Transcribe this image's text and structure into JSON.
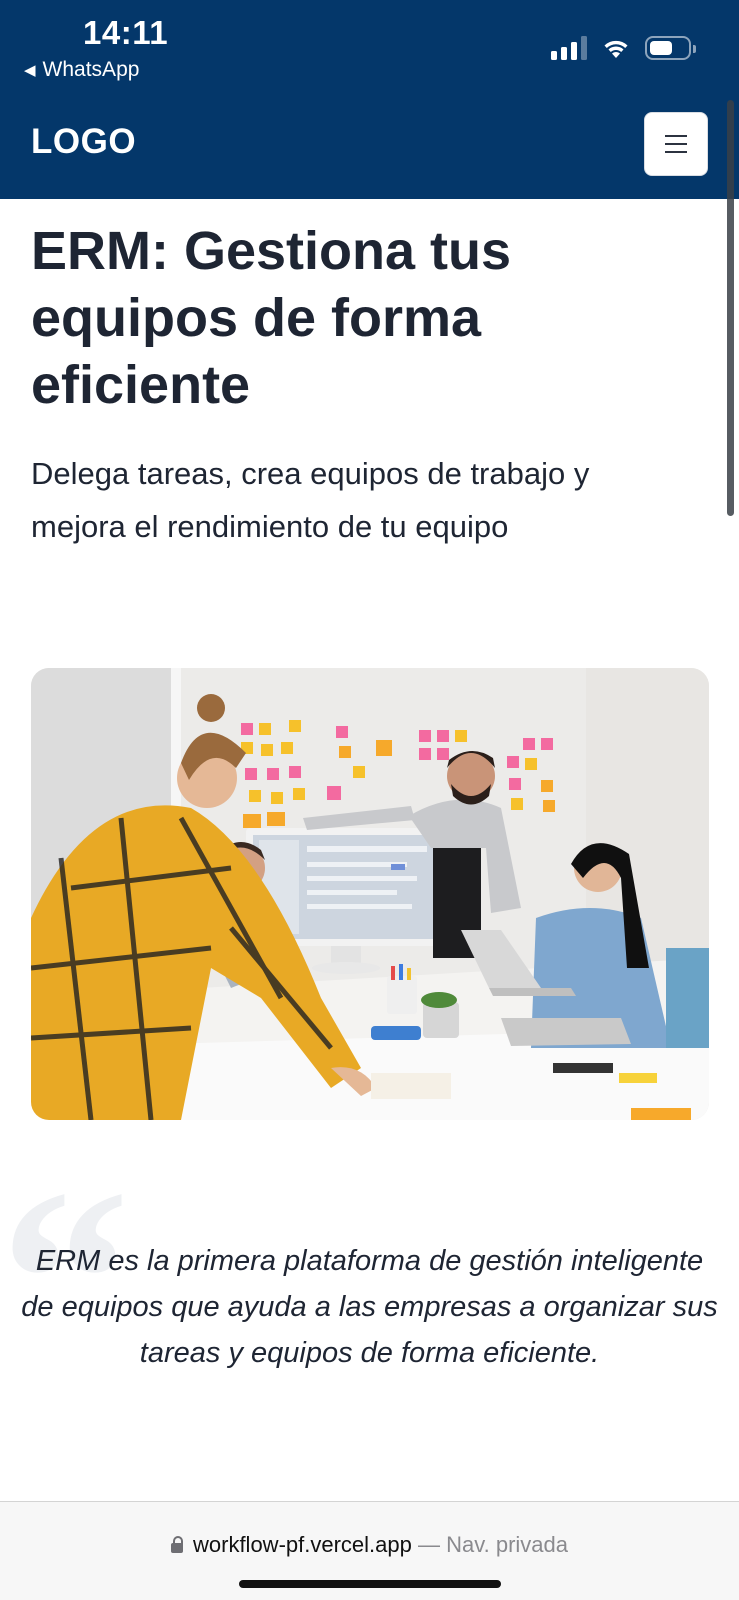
{
  "status_bar": {
    "time": "14:11",
    "back_label": "WhatsApp",
    "back_glyph": "◀",
    "icons": [
      "signal-icon",
      "wifi-icon",
      "battery-icon"
    ]
  },
  "header": {
    "logo": "LOGO",
    "menu_icon": "hamburger-menu-icon",
    "background_color": "#04376a"
  },
  "hero": {
    "title": "ERM: Gestiona tus equipos de forma eficiente",
    "subtitle": "Delega tareas, crea equipos de trabajo y mejora el rendimiento de tu equipo"
  },
  "quote": {
    "mark": "“",
    "text": "ERM es la primera plataforma de gestión inteligente de equipos que ayuda a las empresas a organizar sus tareas y equipos de forma eficiente."
  },
  "browser": {
    "lock_icon": "lock-icon",
    "host": "workflow-pf.vercel.app",
    "separator": "—",
    "mode": "Nav. privada"
  }
}
